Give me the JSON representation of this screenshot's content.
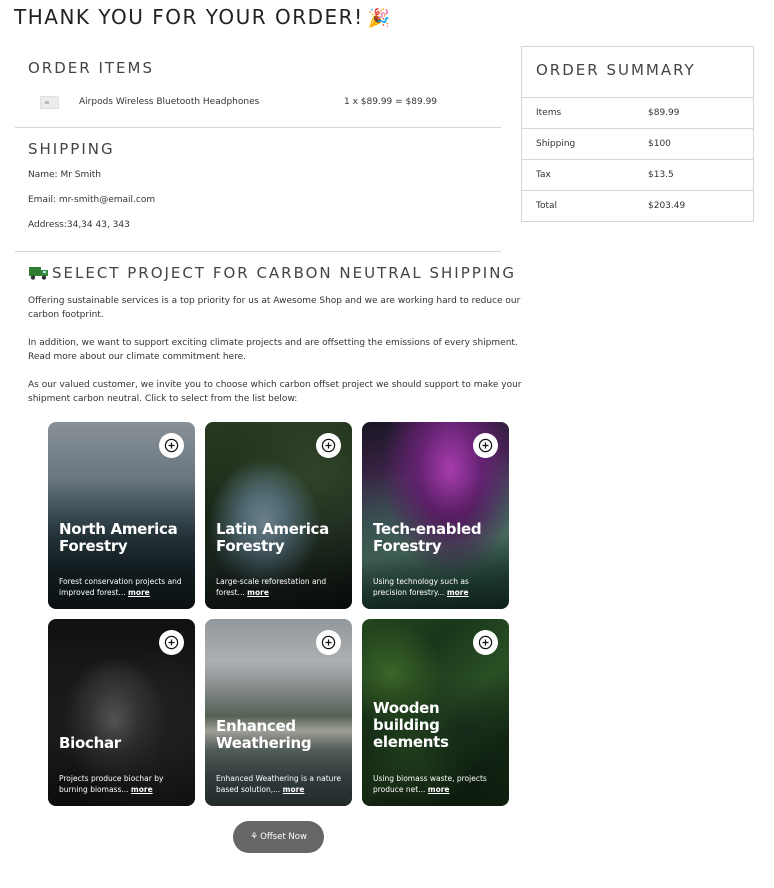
{
  "page": {
    "title": "THANK YOU FOR YOUR ORDER!",
    "title_emoji": "🎉"
  },
  "order_items": {
    "title": "ORDER ITEMS",
    "items": [
      {
        "name": "Airpods Wireless Bluetooth Headphones",
        "price_line": "1 x $89.99 = $89.99"
      }
    ]
  },
  "shipping": {
    "title": "SHIPPING",
    "name_line": "Name: Mr Smith",
    "email_label": "Email:",
    "email_value": "mr-smith@email.com",
    "address_line": "Address:34,34 43, 343"
  },
  "carbon": {
    "title": "SELECT PROJECT FOR CARBON NEUTRAL SHIPPING",
    "para1": "Offering sustainable services is a top priority for us at Awesome Shop and we are working hard to reduce our carbon footprint.",
    "para2": "In addition, we want to support exciting climate projects and are offsetting the emissions of every shipment. Read more about our climate commitment here.",
    "para3": "As our valued customer, we invite you to choose which carbon offset project we should support to make your shipment carbon neutral. Click to select from the list below:",
    "more_label": "more",
    "projects": [
      {
        "title": "North America Forestry",
        "desc": "Forest conservation projects and improved forest...",
        "theme": "mist-forest"
      },
      {
        "title": "Latin America Forestry",
        "desc": "Large-scale reforestation and forest...",
        "theme": "river-forest"
      },
      {
        "title": "Tech-enabled Forestry",
        "desc": "Using technology such as precision forestry...",
        "theme": "space-aurora"
      },
      {
        "title": "Biochar",
        "desc": "Projects produce biochar by burning biomass...",
        "theme": "dark-rock"
      },
      {
        "title": "Enhanced Weathering",
        "desc": "Enhanced Weathering is a nature based solution,...",
        "theme": "white-cliffs"
      },
      {
        "title": "Wooden building elements",
        "desc": "Using biomass waste, projects produce net...",
        "theme": "green-canopy"
      }
    ],
    "offset_button": "Offset Now"
  },
  "summary": {
    "title": "ORDER SUMMARY",
    "rows": [
      {
        "label": "Items",
        "value": "$89.99"
      },
      {
        "label": "Shipping",
        "value": "$100"
      },
      {
        "label": "Tax",
        "value": "$13.5"
      },
      {
        "label": "Total",
        "value": "$203.49"
      }
    ]
  },
  "colors": {
    "offset_button": "#666666",
    "border": "#d6d6d6"
  }
}
